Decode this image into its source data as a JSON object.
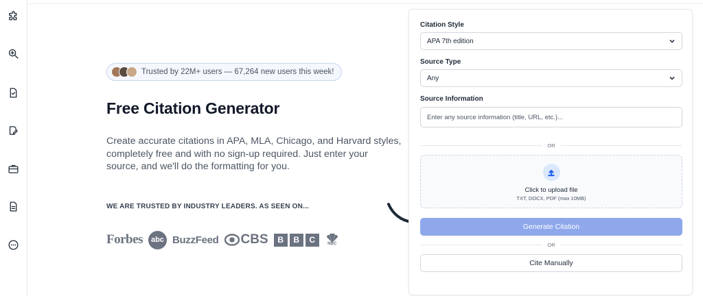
{
  "sidebar": {
    "items": [
      {
        "icon": "puzzle-icon"
      },
      {
        "icon": "zoom-in-icon"
      },
      {
        "icon": "document-check-icon"
      },
      {
        "icon": "document-edit-icon"
      },
      {
        "icon": "briefcase-icon"
      },
      {
        "icon": "document-text-icon"
      },
      {
        "icon": "more-circle-icon"
      }
    ]
  },
  "hero": {
    "badge_text": "Trusted by 22M+ users — 67,264 new users this week!",
    "title": "Free Citation Generator",
    "description": "Create accurate citations in APA, MLA, Chicago, and Harvard styles, completely free and with no sign-up required. Just enter your source, and we'll do the formatting for you.",
    "trusted_label": "WE ARE TRUSTED BY INDUSTRY LEADERS. AS SEEN ON...",
    "logos": {
      "forbes": "Forbes",
      "abc": "abc",
      "buzzfeed": "BuzzFeed",
      "cbs": "CBS",
      "bbc": [
        "B",
        "B",
        "C"
      ],
      "nbc": "NBC"
    }
  },
  "form": {
    "citation_style_label": "Citation Style",
    "citation_style_value": "APA 7th edition",
    "source_type_label": "Source Type",
    "source_type_value": "Any",
    "source_info_label": "Source Information",
    "source_info_placeholder": "Enter any source information (title, URL, etc.)...",
    "or_text_1": "OR",
    "upload_title": "Click to upload file",
    "upload_subtitle": "TXT, DOCX, PDF (max 10MB)",
    "generate_button": "Generate Citation",
    "or_text_2": "OR",
    "cite_manually_button": "Cite Manually"
  },
  "colors": {
    "primary_button": "#8fa8ec",
    "upload_accent": "#2563eb",
    "badge_border": "#c9d7f0"
  }
}
